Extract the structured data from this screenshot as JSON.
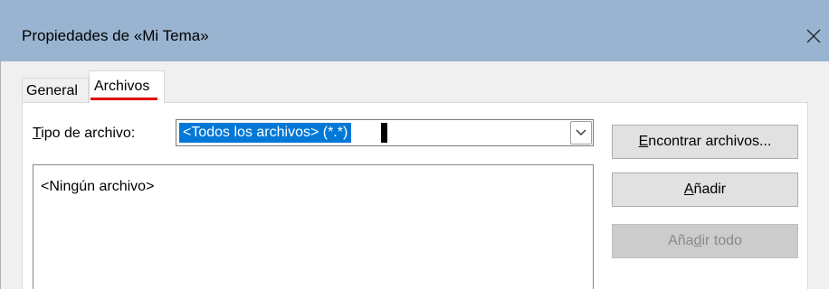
{
  "window": {
    "title": "Propiedades de «Mi Tema»",
    "close_icon": "close-icon"
  },
  "tabs": [
    {
      "label": "General",
      "selected": false
    },
    {
      "label": "Archivos",
      "selected": true
    }
  ],
  "file_type": {
    "label_accel": "T",
    "label_rest": "ipo de archivo:",
    "value": "<Todos los archivos> (*.*)",
    "arrow_icon": "chevron-down-icon"
  },
  "file_list": {
    "items": [
      "<Ningún archivo>"
    ]
  },
  "buttons": {
    "find": {
      "accel": "E",
      "rest": "ncontrar archivos..."
    },
    "add": {
      "accel": "A",
      "rest": "ñadir"
    },
    "add_all": {
      "pre": "Aña",
      "accel": "d",
      "rest": "ir todo",
      "disabled": true
    }
  }
}
